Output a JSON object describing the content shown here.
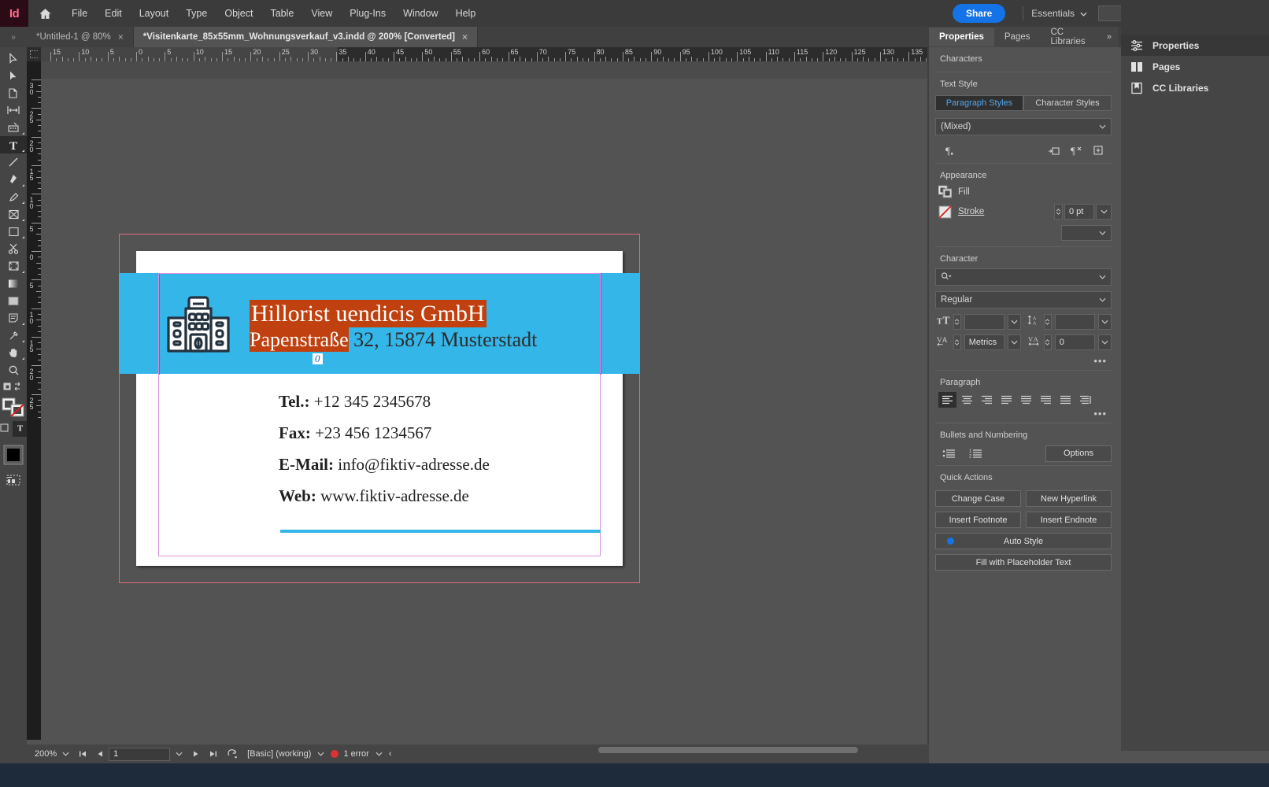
{
  "app": {
    "name": "Adobe InDesign",
    "logo_text": "Id"
  },
  "menubar": {
    "items": [
      "File",
      "Edit",
      "Layout",
      "Type",
      "Object",
      "Table",
      "View",
      "Plug-Ins",
      "Window",
      "Help"
    ],
    "home_icon": "home-icon",
    "share_label": "Share",
    "workspace": "Essentials",
    "search_placeholder": "",
    "minimize": "—",
    "restore": "❐"
  },
  "tabs": [
    {
      "title": "*Untitled-1 @ 80%",
      "active": false,
      "close": "×"
    },
    {
      "title": "*Visitenkarte_85x55mm_Wohnungsverkauf_v3.indd @ 200% [Converted]",
      "active": true,
      "close": "×"
    }
  ],
  "toolbox": {
    "tools": [
      {
        "name": "selection-tool",
        "selected": false
      },
      {
        "name": "direct-selection-tool",
        "selected": false
      },
      {
        "name": "page-tool",
        "selected": false
      },
      {
        "name": "gap-tool",
        "selected": false
      },
      {
        "name": "content-collector-tool",
        "selected": false
      },
      {
        "name": "type-tool",
        "selected": true
      },
      {
        "name": "line-tool",
        "selected": false
      },
      {
        "name": "pen-tool",
        "selected": false
      },
      {
        "name": "pencil-tool",
        "selected": false
      },
      {
        "name": "frame-tool",
        "selected": false
      },
      {
        "name": "rectangle-tool",
        "selected": false
      },
      {
        "name": "scissors-tool",
        "selected": false
      },
      {
        "name": "free-transform-tool",
        "selected": false
      },
      {
        "name": "gradient-swatch-tool",
        "selected": false
      },
      {
        "name": "gradient-feather-tool",
        "selected": false
      },
      {
        "name": "note-tool",
        "selected": false
      },
      {
        "name": "eyedropper-tool",
        "selected": false
      },
      {
        "name": "hand-tool",
        "selected": false
      },
      {
        "name": "zoom-tool",
        "selected": false
      }
    ]
  },
  "rulers": {
    "units": "mm",
    "horizontal_labels": [
      "15",
      "10",
      "5",
      "0",
      "5",
      "10",
      "15",
      "20",
      "25",
      "30",
      "35",
      "40",
      "45",
      "50",
      "55",
      "60",
      "65",
      "70",
      "75",
      "80",
      "85",
      "90",
      "95",
      "100",
      "105",
      "110",
      "115",
      "120",
      "125",
      "130",
      "135"
    ],
    "vertical_labels": [
      "30",
      "25",
      "20",
      "15",
      "10",
      "5",
      "0",
      "5",
      "10",
      "15",
      "20",
      "25"
    ]
  },
  "document": {
    "card": {
      "headline": "Hillorist uendicis GmbH",
      "address_selected": "Papenstraße",
      "address_rest": " 32, 15874 Musterstadt",
      "caret_marker": "0",
      "logo_icon": "building-icon",
      "contacts": [
        {
          "label": "Tel.:",
          "value": " +12 345 2345678"
        },
        {
          "label": "Fax:",
          "value": " +23 456 1234567"
        },
        {
          "label": "E-Mail:",
          "value": " info@fiktiv-adresse.de"
        },
        {
          "label": "Web:",
          "value": " www.fiktiv-adresse.de"
        }
      ]
    },
    "colors": {
      "band_cyan": "#35b6e8",
      "selection_orange": "#c0400f",
      "bleed_line": "#e06a7a",
      "margin_guide": "#d98fe0",
      "frame_guide": "#7a5bd0"
    }
  },
  "properties_panel": {
    "tabs": [
      {
        "label": "Properties",
        "active": true
      },
      {
        "label": "Pages",
        "active": false
      },
      {
        "label": "CC Libraries",
        "active": false
      }
    ],
    "collapse_icon": "chevron-double-right-icon",
    "context_title": "Characters",
    "text_style": {
      "section_label": "Text Style",
      "paragraph_styles_label": "Paragraph Styles",
      "character_styles_label": "Character Styles",
      "active_segment": "Paragraph Styles",
      "style_value": "(Mixed)",
      "icons": [
        "paragraph-mark-icon",
        "load-styles-icon",
        "clear-overrides-icon",
        "new-style-icon"
      ]
    },
    "appearance": {
      "section_label": "Appearance",
      "fill_label": "Fill",
      "stroke_label": "Stroke",
      "stroke_weight": "0 pt",
      "fill_icon": "fill-swatch-icon",
      "stroke_icon": "stroke-none-icon"
    },
    "character": {
      "section_label": "Character",
      "font_family": "",
      "font_family_icon": "font-search-icon",
      "font_style": "Regular",
      "font_size": "",
      "leading": "",
      "kerning": "Metrics",
      "tracking": "0",
      "more_options": "•••",
      "icons": [
        "font-size-icon",
        "leading-icon",
        "kerning-icon",
        "tracking-icon"
      ]
    },
    "paragraph": {
      "section_label": "Paragraph",
      "alignments": [
        "align-left",
        "align-center",
        "align-right",
        "justify-last-left",
        "justify-last-center",
        "justify-last-right",
        "justify-all",
        "align-toward-spine"
      ],
      "active_alignment": "align-left",
      "more_options": "•••"
    },
    "bullets": {
      "section_label": "Bullets and Numbering",
      "bulleted_list_icon": "bulleted-list-icon",
      "numbered_list_icon": "numbered-list-icon",
      "options_label": "Options"
    },
    "quick_actions": {
      "section_label": "Quick Actions",
      "buttons": [
        "Change Case",
        "New Hyperlink",
        "Insert Footnote",
        "Insert Endnote"
      ],
      "auto_style_label": "Auto Style",
      "placeholder_label": "Fill with Placeholder Text"
    }
  },
  "right_rail": {
    "items": [
      {
        "label": "Properties",
        "icon": "properties-sliders-icon",
        "active": true
      },
      {
        "label": "Pages",
        "icon": "pages-icon",
        "active": false
      },
      {
        "label": "CC Libraries",
        "icon": "cc-libraries-icon",
        "active": false
      }
    ]
  },
  "statusbar": {
    "zoom": "200%",
    "zoom_chevron": "chevron-down-icon",
    "first_page_icon": "first-page-icon",
    "prev_page_icon": "previous-page-icon",
    "page_number": "1",
    "page_chevron": "chevron-down-icon",
    "next_page_icon": "next-page-icon",
    "last_page_icon": "last-page-icon",
    "preflight_icon": "preflight-icon",
    "preflight_profile": "[Basic] (working)",
    "profile_chevron": "chevron-down-icon",
    "error_text": "1 error",
    "error_color": "#e03131",
    "error_chevron": "chevron-down-icon",
    "overflow": "‹"
  }
}
